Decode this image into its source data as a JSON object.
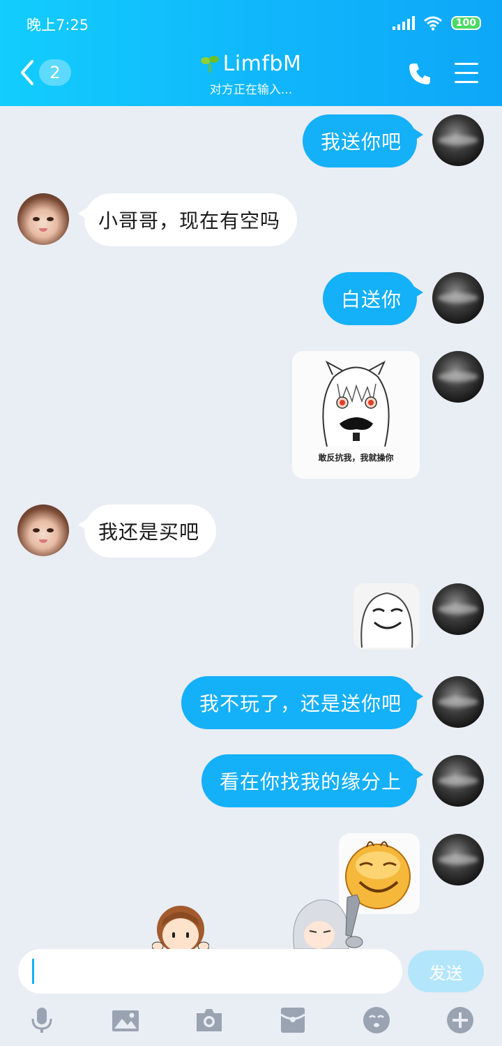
{
  "status_bar": {
    "time": "晚上7:25",
    "battery": "100"
  },
  "header": {
    "unread_count": "2",
    "contact_name": "LimfbM",
    "typing_status": "对方正在输入..."
  },
  "messages": [
    {
      "side": "out",
      "type": "text",
      "text": "我送你吧"
    },
    {
      "side": "in",
      "type": "text",
      "text": "小哥哥，现在有空吗"
    },
    {
      "side": "out",
      "type": "text",
      "text": "白送你"
    },
    {
      "side": "out",
      "type": "sticker",
      "caption": "敢反抗我，我就操你"
    },
    {
      "side": "in",
      "type": "text",
      "text": "我还是买吧"
    },
    {
      "side": "out",
      "type": "sticker"
    },
    {
      "side": "out",
      "type": "text",
      "text": "我不玩了，还是送你吧"
    },
    {
      "side": "out",
      "type": "text",
      "text": "看在你找我的缘分上"
    },
    {
      "side": "out",
      "type": "sticker"
    }
  ],
  "composer": {
    "send_label": "发送",
    "input_value": ""
  },
  "toolbar": [
    "microphone-icon",
    "image-icon",
    "camera-icon",
    "red-packet-icon",
    "emoji-icon",
    "plus-icon"
  ],
  "colors": {
    "header": "#12cdfd",
    "bubble_out": "#14b0f8",
    "background": "#e9edf4",
    "send_button": "#b3e6fb"
  }
}
